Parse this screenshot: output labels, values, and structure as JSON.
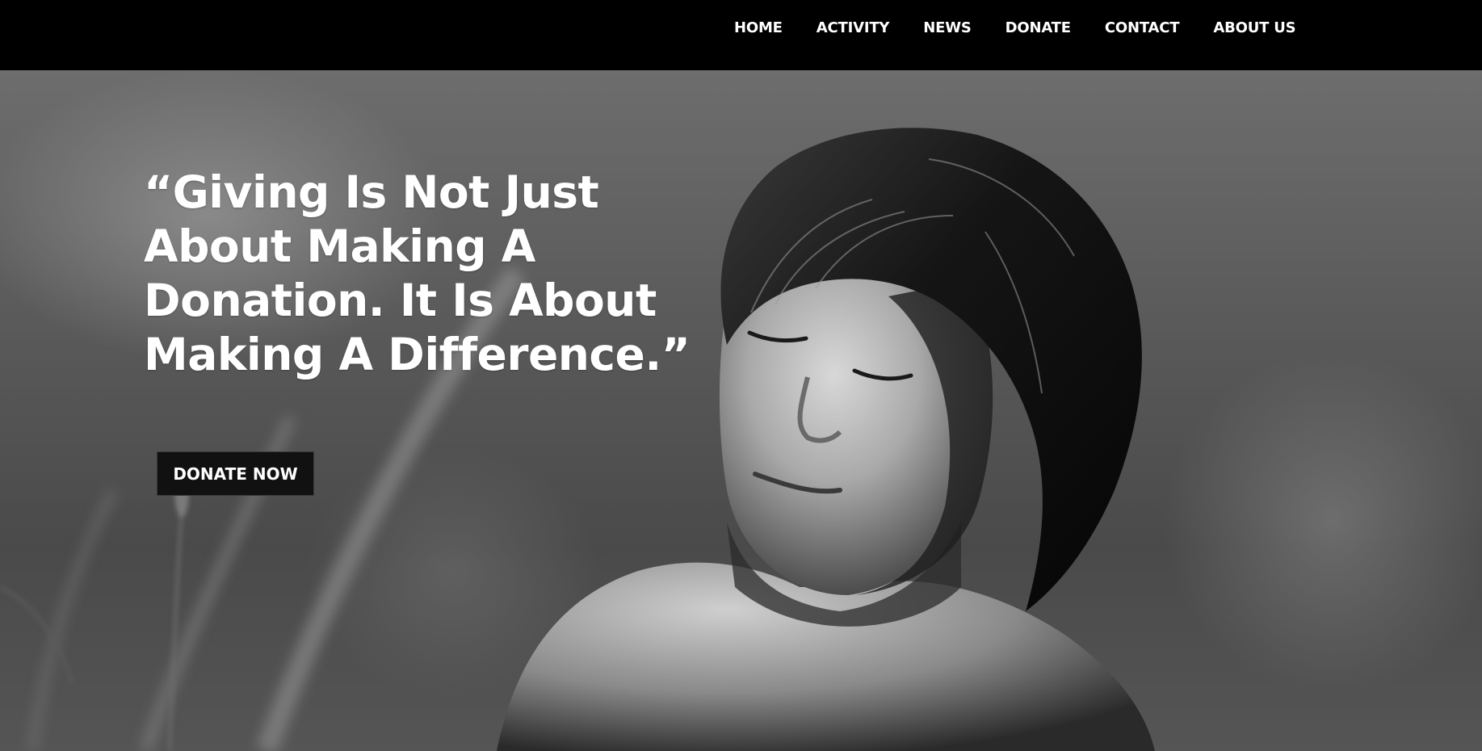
{
  "nav": {
    "items": [
      {
        "label": "HOME"
      },
      {
        "label": "ACTIVITY"
      },
      {
        "label": "NEWS"
      },
      {
        "label": "DONATE"
      },
      {
        "label": "CONTACT"
      },
      {
        "label": "ABOUT US"
      }
    ]
  },
  "hero": {
    "quote": "“Giving Is Not Just About Making A Donation. It Is About Making A Difference.”",
    "cta_label": "DONATE NOW",
    "image_description_icon": "boy-eyes-closed-photo"
  },
  "colors": {
    "nav_background": "#000000",
    "nav_text": "#ffffff",
    "quote_text": "#ffffff",
    "button_background": "#111111",
    "button_text": "#ffffff"
  }
}
